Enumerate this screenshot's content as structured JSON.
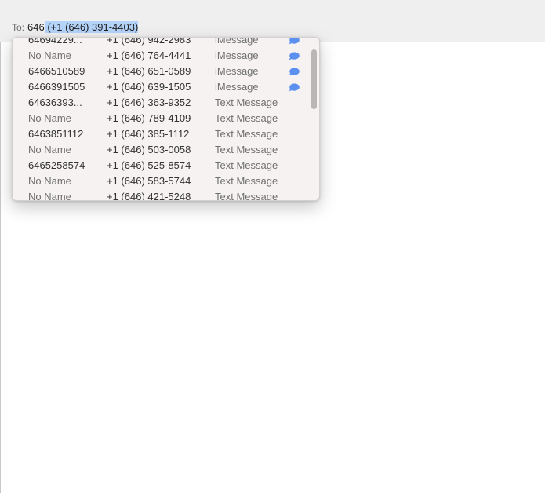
{
  "header": {
    "to_label": "To:",
    "typed_text": "646",
    "suggested_completion": " (+1 (646) 391-4403)"
  },
  "dropdown": {
    "rows": [
      {
        "name": "64694229...",
        "phone": "+1 (646) 942-2983",
        "service": "iMessage",
        "muted": false,
        "imessage": true
      },
      {
        "name": "No Name",
        "phone": "+1 (646) 764-4441",
        "service": "iMessage",
        "muted": true,
        "imessage": true
      },
      {
        "name": "6466510589",
        "phone": "+1 (646) 651-0589",
        "service": "iMessage",
        "muted": false,
        "imessage": true
      },
      {
        "name": "6466391505",
        "phone": "+1 (646) 639-1505",
        "service": "iMessage",
        "muted": false,
        "imessage": true
      },
      {
        "name": "64636393...",
        "phone": "+1 (646) 363-9352",
        "service": "Text Message",
        "muted": false,
        "imessage": false
      },
      {
        "name": "No Name",
        "phone": "+1 (646) 789-4109",
        "service": "Text Message",
        "muted": true,
        "imessage": false
      },
      {
        "name": "6463851112",
        "phone": "+1 (646) 385-1112",
        "service": "Text Message",
        "muted": false,
        "imessage": false
      },
      {
        "name": "No Name",
        "phone": "+1 (646) 503-0058",
        "service": "Text Message",
        "muted": true,
        "imessage": false
      },
      {
        "name": "6465258574",
        "phone": "+1 (646) 525-8574",
        "service": "Text Message",
        "muted": false,
        "imessage": false
      },
      {
        "name": "No Name",
        "phone": "+1 (646) 583-5744",
        "service": "Text Message",
        "muted": true,
        "imessage": false
      },
      {
        "name": "No Name",
        "phone": "+1 (646) 421-5248",
        "service": "Text Message",
        "muted": true,
        "imessage": false
      }
    ]
  },
  "colors": {
    "imessage_bubble": "#5b8ff0",
    "selection_highlight": "#b4d3f8"
  },
  "icons": {
    "imessage_indicator": "speech-bubble-icon"
  }
}
